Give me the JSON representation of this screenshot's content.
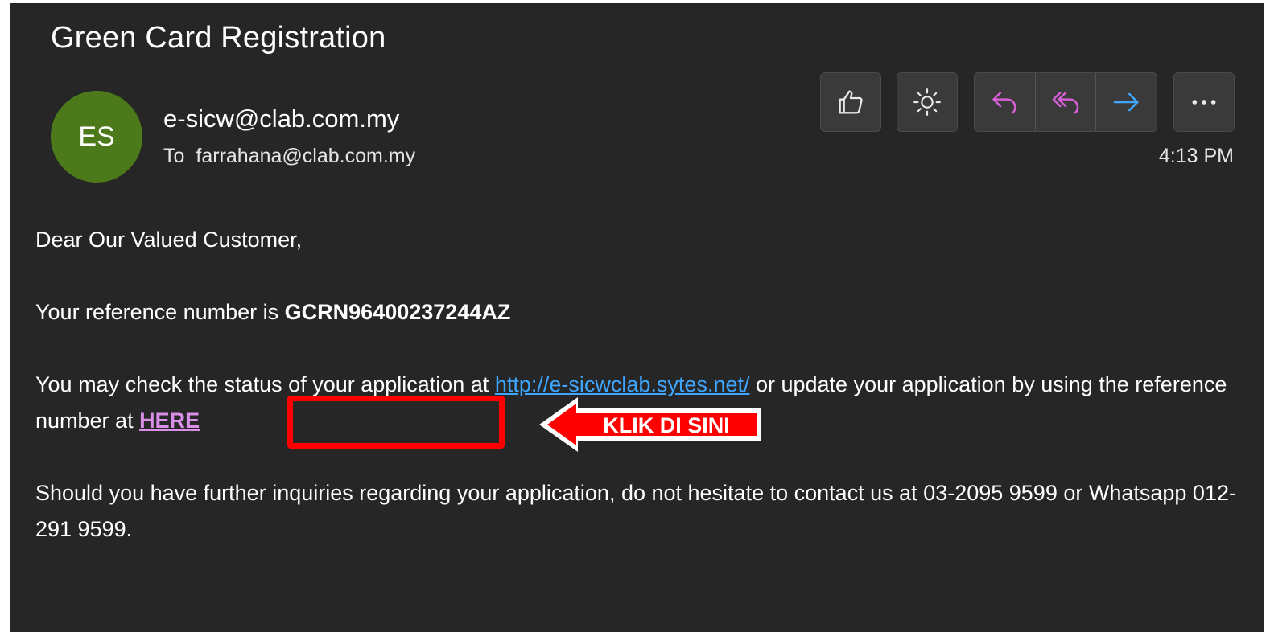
{
  "email": {
    "subject": "Green Card Registration",
    "avatar_initials": "ES",
    "sender": "e-sicw@clab.com.my",
    "to_label": "To",
    "recipient": "farrahana@clab.com.my",
    "time": "4:13 PM",
    "colors": {
      "background": "#262626",
      "avatar": "#4c7a1b",
      "link": "#3ea6ff",
      "here_link": "#d98ee8",
      "reply_icon": "#d85fd8",
      "forward_icon": "#3ea6ff",
      "annotation_red": "#ff0000"
    }
  },
  "toolbar": {
    "like_icon": "thumbs-up-icon",
    "theme_icon": "sun-icon",
    "reply_icon": "reply-icon",
    "reply_all_icon": "reply-all-icon",
    "forward_icon": "forward-icon",
    "more_icon": "more-icon"
  },
  "body": {
    "greeting": "Dear Our Valued Customer,",
    "ref_prefix": "Your reference number is ",
    "ref_number": "GCRN96400237244AZ",
    "status_prefix": "You may check the status of your application at ",
    "status_link": "http://e-sicwclab.sytes.net/",
    "status_mid": " or update your application by using the reference number at ",
    "here_link": "HERE",
    "inquiry": "Should you have further inquiries regarding your application, do not hesitate to contact us at 03-2095 9599 or Whatsapp 012-291 9599."
  },
  "annotation": {
    "arrow_label": "KLIK DI SINI"
  }
}
